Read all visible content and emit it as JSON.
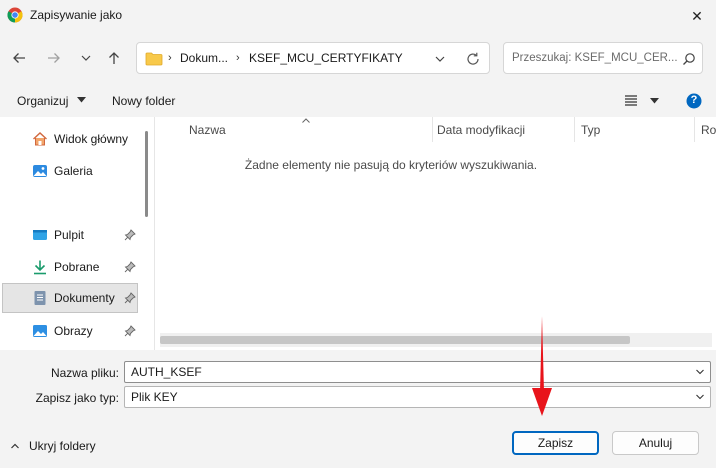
{
  "window": {
    "title": "Zapisywanie jako",
    "close_glyph": "✕"
  },
  "nav": {
    "back_icon": "arrow-left-icon",
    "forward_icon": "arrow-right-icon",
    "recent_icon": "chevron-down-icon",
    "up_icon": "arrow-up-icon",
    "breadcrumb": [
      "Dokum...",
      "KSEF_MCU_CERTYFIKATY"
    ],
    "crumb_separator": "›",
    "search_placeholder": "Przeszukaj: KSEF_MCU_CER..."
  },
  "toolbar": {
    "organize_label": "Organizuj",
    "new_folder_label": "Nowy folder",
    "view_icon": "list-view-icon",
    "help_glyph": "?"
  },
  "sidebar": {
    "items": [
      {
        "label": "Widok główny",
        "icon": "home-icon",
        "pinned": false,
        "selected": false
      },
      {
        "label": "Galeria",
        "icon": "gallery-icon",
        "pinned": false,
        "selected": false
      },
      {
        "label": "Pulpit",
        "icon": "desktop-icon",
        "pinned": true,
        "selected": false
      },
      {
        "label": "Pobrane",
        "icon": "download-icon",
        "pinned": true,
        "selected": false
      },
      {
        "label": "Dokumenty",
        "icon": "documents-icon",
        "pinned": true,
        "selected": true
      },
      {
        "label": "Obrazy",
        "icon": "pictures-icon",
        "pinned": true,
        "selected": false
      }
    ]
  },
  "filelist": {
    "columns": [
      "Nazwa",
      "Data modyfikacji",
      "Typ",
      "Roz"
    ],
    "empty_message": "Żadne elementy nie pasują do kryteriów wyszukiwania."
  },
  "form": {
    "filename_label": "Nazwa pliku:",
    "filename_value": "AUTH_KSEF",
    "filetype_label": "Zapisz jako typ:",
    "filetype_value": "Plik KEY"
  },
  "footer": {
    "hide_folders_label": "Ukryj foldery",
    "save_label": "Zapisz",
    "cancel_label": "Anuluj"
  },
  "colors": {
    "accent": "#0067c0",
    "annotation_arrow": "#e8141b",
    "help_circle": "#0067c0"
  }
}
